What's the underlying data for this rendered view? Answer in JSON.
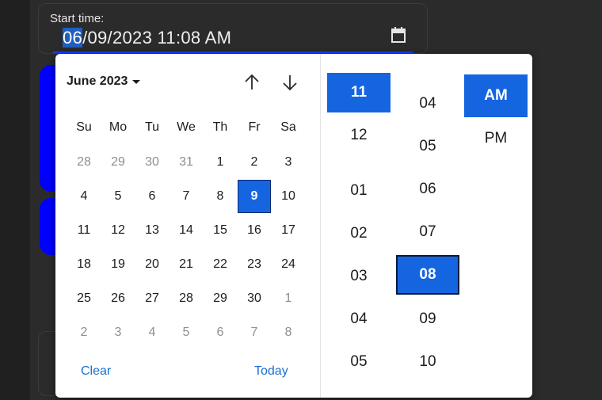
{
  "field": {
    "label": "Start time:",
    "value_selected": "06",
    "value_rest": "/09/2023 11:08 AM"
  },
  "calendar": {
    "month_label": "June 2023",
    "weekdays": [
      "Su",
      "Mo",
      "Tu",
      "We",
      "Th",
      "Fr",
      "Sa"
    ],
    "weeks": [
      [
        "28",
        "29",
        "30",
        "31",
        "1",
        "2",
        "3"
      ],
      [
        "4",
        "5",
        "6",
        "7",
        "8",
        "9",
        "10"
      ],
      [
        "11",
        "12",
        "13",
        "14",
        "15",
        "16",
        "17"
      ],
      [
        "18",
        "19",
        "20",
        "21",
        "22",
        "23",
        "24"
      ],
      [
        "25",
        "26",
        "27",
        "28",
        "29",
        "30",
        "1"
      ],
      [
        "2",
        "3",
        "4",
        "5",
        "6",
        "7",
        "8"
      ]
    ],
    "selected_day": "9",
    "clear_label": "Clear",
    "today_label": "Today"
  },
  "time": {
    "hours": [
      "11",
      "12",
      "01",
      "02",
      "03",
      "04",
      "05"
    ],
    "selected_hour": "11",
    "minutes": [
      "04",
      "05",
      "06",
      "07",
      "08",
      "09",
      "10"
    ],
    "selected_minute": "08",
    "meridiem": [
      "AM",
      "PM"
    ],
    "selected_meridiem": "AM"
  },
  "colors": {
    "accent": "#1565e0",
    "link": "#1a6fd1",
    "underline": "#1a3bff"
  }
}
